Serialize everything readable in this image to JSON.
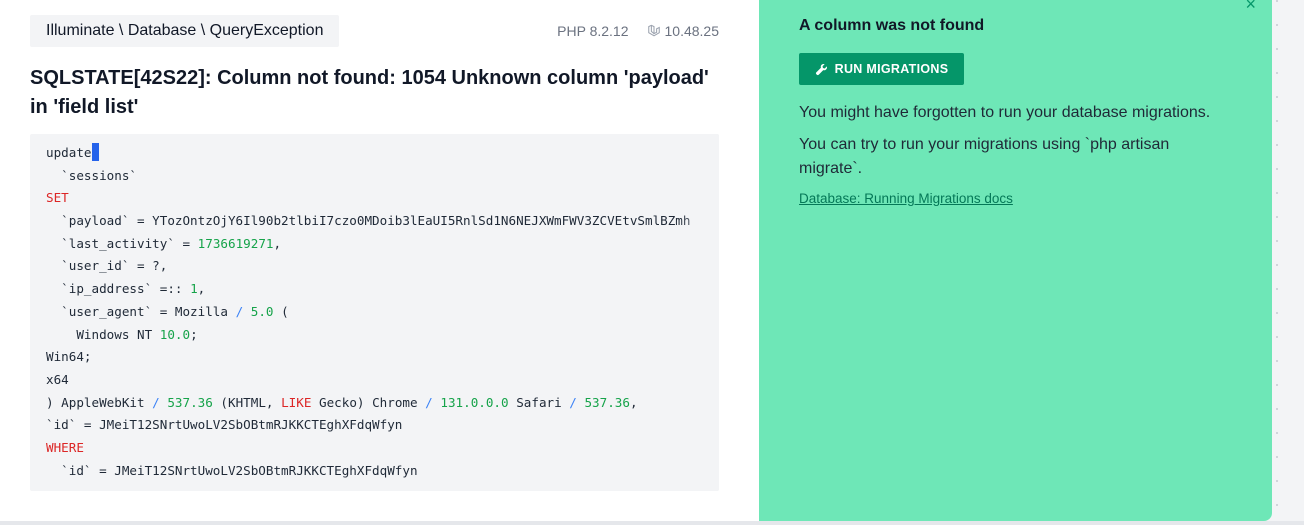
{
  "exception": {
    "class": "Illuminate \\ Database \\ QueryException",
    "php_version": "PHP 8.2.12",
    "laravel_version": "10.48.25",
    "message": "SQLSTATE[42S22]: Column not found: 1054 Unknown column 'payload' in 'field list'"
  },
  "code": {
    "lines": [
      [
        {
          "t": "update"
        }
      ],
      [
        {
          "t": "  `sessions`"
        }
      ],
      [
        {
          "t": "SET",
          "c": "kw"
        }
      ],
      [
        {
          "t": "  `payload` = YTozOntzOjY6Il90b2tlbiI7czo0MDoib3lEaUI5RnlSd1N6NEJXWmFWV3ZCVEtvSmlBZmh"
        }
      ],
      [
        {
          "t": "  `last_activity` = "
        },
        {
          "t": "1736619271",
          "c": "num"
        },
        {
          "t": ","
        }
      ],
      [
        {
          "t": "  `user_id` = ?,"
        }
      ],
      [
        {
          "t": "  `ip_address` =:: "
        },
        {
          "t": "1",
          "c": "num"
        },
        {
          "t": ","
        }
      ],
      [
        {
          "t": "  `user_agent` = Mozilla "
        },
        {
          "t": "/",
          "c": "op"
        },
        {
          "t": " "
        },
        {
          "t": "5.0",
          "c": "num"
        },
        {
          "t": " ("
        }
      ],
      [
        {
          "t": "    Windows NT "
        },
        {
          "t": "10.0",
          "c": "num"
        },
        {
          "t": ";"
        }
      ],
      [
        {
          "t": "Win64;"
        }
      ],
      [
        {
          "t": "x64"
        }
      ],
      [
        {
          "t": ") AppleWebKit "
        },
        {
          "t": "/",
          "c": "op"
        },
        {
          "t": " "
        },
        {
          "t": "537.36",
          "c": "num"
        },
        {
          "t": " (KHTML, "
        },
        {
          "t": "LIKE",
          "c": "kw"
        },
        {
          "t": " Gecko) Chrome "
        },
        {
          "t": "/",
          "c": "op"
        },
        {
          "t": " "
        },
        {
          "t": "131.0.0.0",
          "c": "num"
        },
        {
          "t": " Safari "
        },
        {
          "t": "/",
          "c": "op"
        },
        {
          "t": " "
        },
        {
          "t": "537.36",
          "c": "num"
        },
        {
          "t": ","
        }
      ],
      [
        {
          "t": "`id` = JMeiT12SNrtUwoLV2SbOBtmRJKKCTEghXFdqWfyn"
        }
      ],
      [
        {
          "t": "WHERE",
          "c": "kw"
        }
      ],
      [
        {
          "t": "  `id` = JMeiT12SNrtUwoLV2SbOBtmRJKKCTEghXFdqWfyn"
        }
      ]
    ]
  },
  "solution": {
    "close_glyph": "×",
    "title": "A column was not found",
    "button_label": "RUN MIGRATIONS",
    "text1": "You might have forgotten to run your database migrations.",
    "text2": "You can try to run your migrations using `php artisan migrate`.",
    "link": "Database: Running Migrations docs"
  },
  "colors": {
    "solution_bg": "#6ee7b7",
    "button_bg": "#059669",
    "keyword": "#dc2626",
    "number": "#16a34a",
    "cursor": "#2563eb"
  }
}
